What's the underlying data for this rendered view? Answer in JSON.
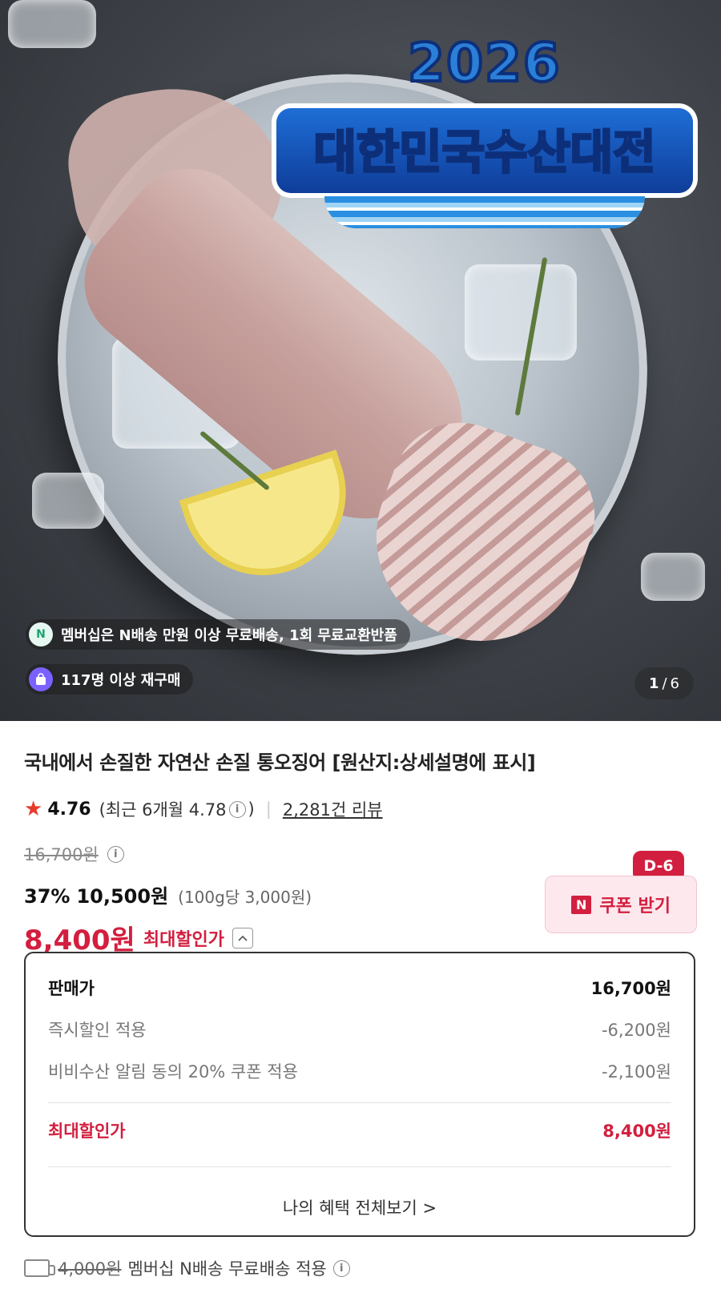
{
  "hero": {
    "banner_year": "2026",
    "banner_title": "대한민국수산대전",
    "pill_membership": "멤버십은 N배송 만원 이상 무료배송, 1회 무료교환반품",
    "pill_membership_icon_text": "N",
    "pill_repurchase": "117명 이상 재구매",
    "counter_current": "1",
    "counter_total": "6"
  },
  "product": {
    "title": "국내에서 손질한 자연산 손질 통오징어 [원산지:상세설명에 표시]"
  },
  "rating": {
    "score": "4.76",
    "recent_prefix": "(최근 6개월 4.78",
    "recent_suffix": ")",
    "info_icon": "i",
    "separator": "|",
    "review_count": "2,281건 리뷰"
  },
  "price": {
    "original": "16,700원",
    "discount_rate": "37%",
    "discounted": "10,500원",
    "unit_price": "(100g당 3,000원)",
    "max_price": "8,400원",
    "max_label": "최대할인가",
    "collapse_icon": "^"
  },
  "coupon": {
    "d_day": "D-6",
    "badge": "N",
    "label": "쿠폰 받기"
  },
  "breakdown": {
    "rows": [
      {
        "label": "판매가",
        "value": "16,700원"
      },
      {
        "label": "즉시할인 적용",
        "value": "-6,200원"
      },
      {
        "label": "비비수산 알림 동의 20% 쿠폰 적용",
        "value": "-2,100원"
      }
    ],
    "max_label": "최대할인가",
    "max_value": "8,400원",
    "benefit_link": "나의 혜택 전체보기 >"
  },
  "shipping": {
    "original_fee": "4,000원",
    "text": "멤버십 N배송 무료배송 적용",
    "info_icon": "i"
  },
  "colors": {
    "accent_red": "#d31f3f",
    "star": "#e8392b",
    "coupon_bg": "#fde8ee"
  }
}
